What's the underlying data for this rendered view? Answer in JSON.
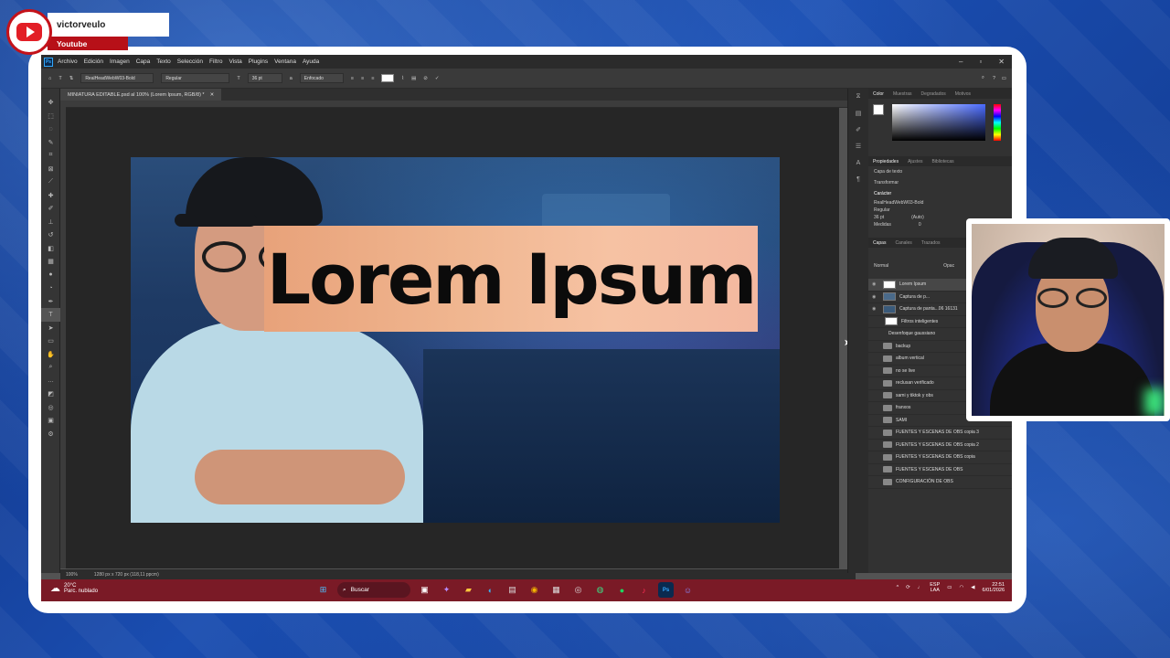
{
  "overlay": {
    "channel_name": "victorveulo",
    "platform": "Youtube"
  },
  "menu": {
    "logo": "Ps",
    "items": [
      "Archivo",
      "Edición",
      "Imagen",
      "Capa",
      "Texto",
      "Selección",
      "Filtro",
      "Vista",
      "Plugins",
      "Ventana",
      "Ayuda"
    ]
  },
  "options": {
    "font": "RealHeadWebW03-Bold",
    "style": "Regular",
    "size": "36 pt",
    "antialias": "Enfocado"
  },
  "document": {
    "tab_title": "MINIATURA EDITABLE.psd al 100% (Lorem Ipsum, RGB/8) *",
    "canvas_text": "Lorem Ipsum",
    "zoom": "100%",
    "dimensions": "1280 px x 720 px (118,11 ppcm)"
  },
  "panels": {
    "color_tabs": [
      "Color",
      "Muestras",
      "Degradados",
      "Motivos"
    ],
    "prop_tabs": [
      "Propiedades",
      "Ajustes",
      "Bibliotecas"
    ],
    "layer_type": "Capa de texto",
    "transform": "Transformar",
    "character": "Carácter",
    "prop_font": "RealHeadWebW03-Bold",
    "prop_style": "Regular",
    "prop_size": "36 pt",
    "prop_auto": "(Auto)",
    "prop_kern": "Medidas",
    "prop_track": "0",
    "layer_tabs": [
      "Capas",
      "Canales",
      "Trazados"
    ],
    "blend_mode": "Normal",
    "opacity": "Opac"
  },
  "layers": [
    "Lorem Ipsum",
    "Captura de p...",
    "Captura de panta...06 16131",
    "Filtros inteligentes",
    "Desenfoque gaussiano",
    "backup",
    "album vertical",
    "no se live",
    "reclusan verificado",
    "sami y tiktok y obs",
    "franxos",
    "SAMI",
    "FUENTES Y ESCENAS DE OBS copia 3",
    "FUENTES Y ESCENAS DE OBS copia 2",
    "FUENTES Y ESCENAS DE OBS copia",
    "FUENTES Y ESCENAS DE OBS",
    "CONFIGURACIÓN DE OBS"
  ],
  "taskbar": {
    "temp": "20°C",
    "weather": "Parc. nublado",
    "search": "Buscar",
    "lang": "ESP",
    "region": "LAA",
    "time": "22:51",
    "date": "6/01/2026"
  }
}
